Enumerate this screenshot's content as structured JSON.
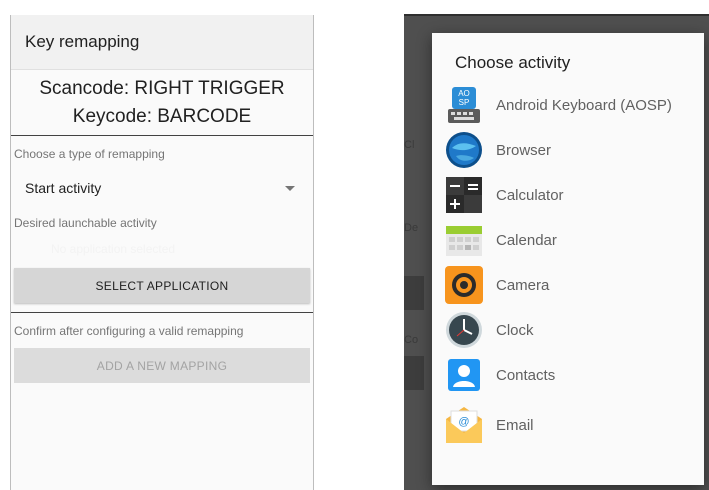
{
  "left": {
    "toolbar_title": "Key remapping",
    "scancode": "Scancode: RIGHT TRIGGER",
    "keycode": "Keycode: BARCODE",
    "type_label": "Choose a type of remapping",
    "type_selected": "Start activity",
    "activity_label": "Desired launchable activity",
    "activity_placeholder": "No application selected",
    "select_button": "SELECT APPLICATION",
    "confirm_label": "Confirm after configuring a valid remapping",
    "add_button": "ADD A NEW MAPPING"
  },
  "dialog": {
    "title": "Choose activity",
    "apps": [
      {
        "label": "Android Keyboard (AOSP)",
        "icon": "keyboard-icon"
      },
      {
        "label": "Browser",
        "icon": "globe-icon"
      },
      {
        "label": "Calculator",
        "icon": "calculator-icon"
      },
      {
        "label": "Calendar",
        "icon": "calendar-icon"
      },
      {
        "label": "Camera",
        "icon": "camera-icon"
      },
      {
        "label": "Clock",
        "icon": "clock-icon"
      },
      {
        "label": "Contacts",
        "icon": "contacts-icon"
      },
      {
        "label": "Email",
        "icon": "email-icon"
      }
    ]
  },
  "colors": {
    "toolbar": "#f1f1f1",
    "button": "#d6d6d6",
    "dim_background": "#4f4f4f",
    "dialog": "#fafafa"
  }
}
